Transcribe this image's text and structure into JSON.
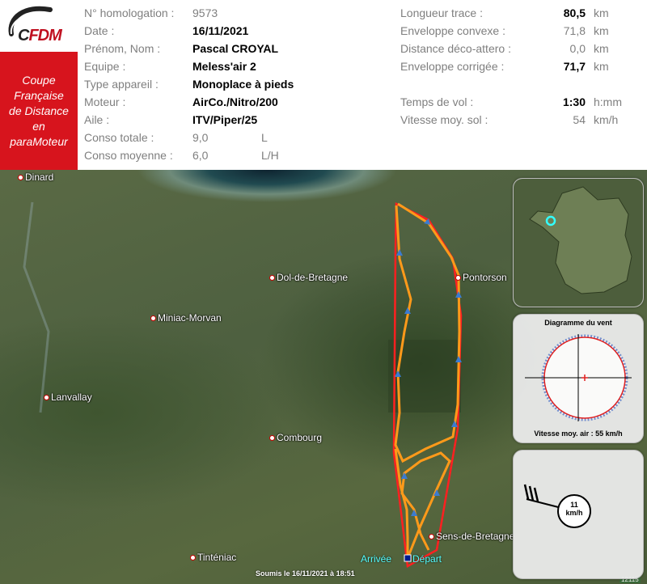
{
  "logo": {
    "c": "C",
    "fdm": "FDM"
  },
  "red_box": {
    "lines": [
      "Coupe",
      "Française",
      "de Distance",
      "en",
      "paraMoteur"
    ]
  },
  "flight_info": {
    "homologation": {
      "label": "N° homologation :",
      "value": "9573"
    },
    "date": {
      "label": "Date :",
      "value": "16/11/2021"
    },
    "pilot": {
      "label": "Prénom, Nom :",
      "value": "Pascal CROYAL"
    },
    "team": {
      "label": "Equipe :",
      "value": "Meless'air 2"
    },
    "aircraft_type": {
      "label": "Type appareil :",
      "value": "Monoplace à pieds"
    },
    "engine": {
      "label": "Moteur :",
      "value": "AirCo./Nitro/200"
    },
    "wing": {
      "label": "Aile :",
      "value": "ITV/Piper/25"
    },
    "total_consumption": {
      "label": "Conso totale :",
      "value": "9,0",
      "unit": "L"
    },
    "avg_consumption": {
      "label": "Conso moyenne :",
      "value": "6,0",
      "unit": "L/H"
    }
  },
  "flight_stats": {
    "track_length": {
      "label": "Longueur trace :",
      "value": "80,5",
      "unit": "km"
    },
    "convex_hull": {
      "label": "Enveloppe convexe :",
      "value": "71,8",
      "unit": "km"
    },
    "takeoff_landing_distance": {
      "label": "Distance déco-attero :",
      "value": "0,0",
      "unit": "km"
    },
    "corrected_hull": {
      "label": "Enveloppe corrigée :",
      "value": "71,7",
      "unit": "km"
    },
    "flight_time": {
      "label": "Temps de vol :",
      "value": "1:30",
      "unit": "h:mm"
    },
    "ground_speed": {
      "label": "Vitesse moy. sol :",
      "value": "54",
      "unit": "km/h"
    }
  },
  "map": {
    "towns": {
      "dinard": "Dinard",
      "dol": "Dol-de-Bretagne",
      "pontorson": "Pontorson",
      "miniac": "Miniac-Morvan",
      "lanvallay": "Lanvallay",
      "combourg": "Combourg",
      "sens": "Sens-de-Bretagne",
      "tinteniac": "Tinténiac"
    },
    "arrivee": "Arrivée",
    "depart": "Départ",
    "submitted": "Soumis le 16/11/2021 à 18:51",
    "ref_id": "12115"
  },
  "wind_panel": {
    "title": "Diagramme du vent",
    "speed_label": "Vitesse moy. air : 55 km/h"
  },
  "wind_arrow": {
    "speed": "11",
    "unit": "km/h"
  },
  "colors": {
    "track": "#ff9a1a",
    "hull": "#ff2020",
    "accent": "#d7141d",
    "cyan": "#55ffff"
  }
}
